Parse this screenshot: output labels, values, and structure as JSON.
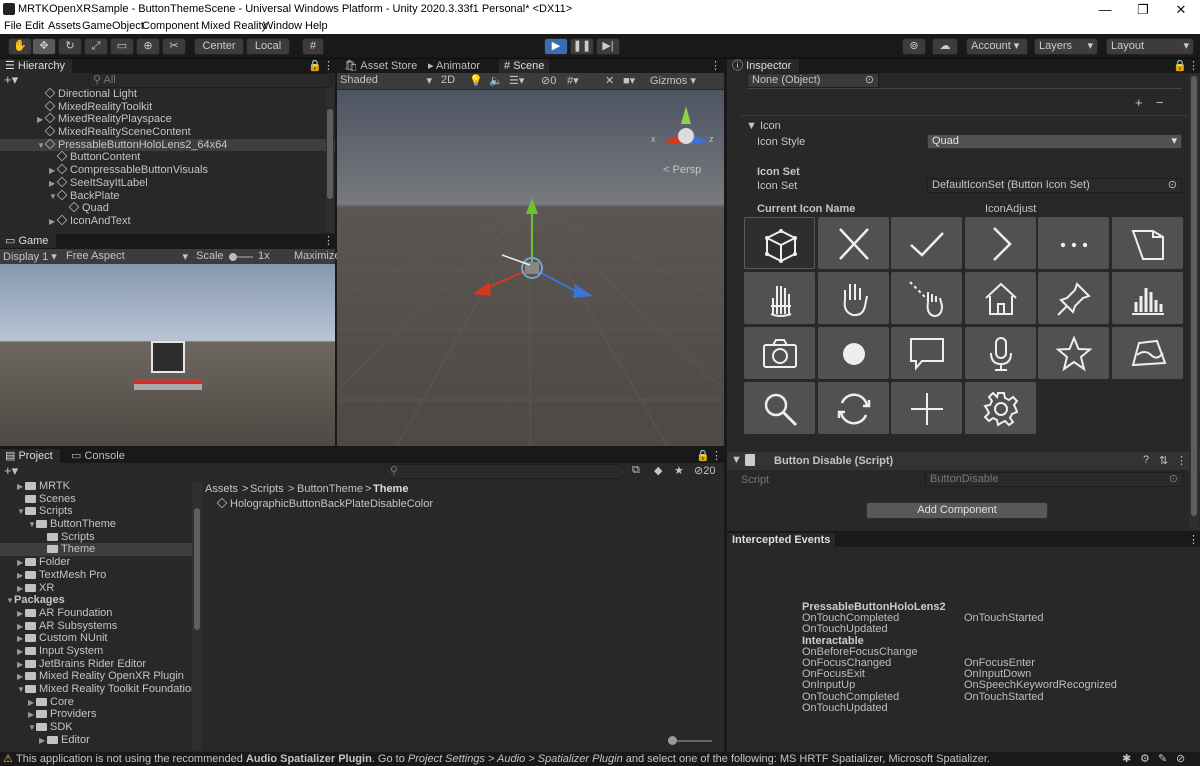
{
  "window": {
    "title": "MRTKOpenXRSample - ButtonThemeScene - Universal Windows Platform - Unity 2020.3.33f1 Personal* <DX11>",
    "min": "—",
    "max": "❐",
    "close": "✕"
  },
  "menu": [
    "File",
    "Edit",
    "Assets",
    "GameObject",
    "Component",
    "Mixed Reality",
    "Window",
    "Help"
  ],
  "toolbar": {
    "center": "Center",
    "local": "Local",
    "account": "Account",
    "layers": "Layers",
    "layout": "Layout"
  },
  "hierarchy": {
    "tab": "Hierarchy",
    "search_placeholder": "All",
    "items": [
      {
        "label": "Directional Light",
        "indent": 3,
        "arrow": ""
      },
      {
        "label": "MixedRealityToolkit",
        "indent": 3,
        "arrow": ""
      },
      {
        "label": "MixedRealityPlayspace",
        "indent": 3,
        "arrow": "▶"
      },
      {
        "label": "MixedRealitySceneContent",
        "indent": 3,
        "arrow": ""
      },
      {
        "label": "PressableButtonHoloLens2_64x64",
        "indent": 3,
        "arrow": "▼",
        "selected": true
      },
      {
        "label": "ButtonContent",
        "indent": 4,
        "arrow": ""
      },
      {
        "label": "CompressableButtonVisuals",
        "indent": 4,
        "arrow": "▶"
      },
      {
        "label": "SeeItSayItLabel",
        "indent": 4,
        "arrow": "▶"
      },
      {
        "label": "BackPlate",
        "indent": 4,
        "arrow": "▼"
      },
      {
        "label": "Quad",
        "indent": 5,
        "arrow": ""
      },
      {
        "label": "IconAndText",
        "indent": 4,
        "arrow": "▶"
      }
    ]
  },
  "game": {
    "tab": "Game",
    "display": "Display 1",
    "aspect": "Free Aspect",
    "scale_label": "Scale",
    "scale_value": "1x",
    "maximize": "Maximize"
  },
  "scene": {
    "tabs": [
      "Asset Store",
      "Animator",
      "Scene"
    ],
    "shading": "Shaded",
    "mode2d": "2D",
    "gizmos": "Gizmos",
    "hidden_count": "0",
    "persp": "Persp",
    "axis_x": "x",
    "axis_z": "z",
    "axis_y": "y"
  },
  "project": {
    "tabs": [
      "Project",
      "Console"
    ],
    "count": "20",
    "breadcrumb": [
      "Assets",
      "Scripts",
      "ButtonTheme",
      "Theme"
    ],
    "asset": "HolographicButtonBackPlateDisableColor",
    "tree": [
      {
        "label": "MRTK",
        "indent": 1,
        "arrow": "▶"
      },
      {
        "label": "Scenes",
        "indent": 1,
        "arrow": ""
      },
      {
        "label": "Scripts",
        "indent": 1,
        "arrow": "▼"
      },
      {
        "label": "ButtonTheme",
        "indent": 2,
        "arrow": "▼"
      },
      {
        "label": "Scripts",
        "indent": 3,
        "arrow": ""
      },
      {
        "label": "Theme",
        "indent": 3,
        "arrow": "",
        "selected": true
      },
      {
        "label": "Folder",
        "indent": 1,
        "arrow": "▶"
      },
      {
        "label": "TextMesh Pro",
        "indent": 1,
        "arrow": "▶"
      },
      {
        "label": "XR",
        "indent": 1,
        "arrow": "▶"
      },
      {
        "label": "Packages",
        "indent": 0,
        "arrow": "▼",
        "bold": true
      },
      {
        "label": "AR Foundation",
        "indent": 1,
        "arrow": "▶"
      },
      {
        "label": "AR Subsystems",
        "indent": 1,
        "arrow": "▶"
      },
      {
        "label": "Custom NUnit",
        "indent": 1,
        "arrow": "▶"
      },
      {
        "label": "Input System",
        "indent": 1,
        "arrow": "▶"
      },
      {
        "label": "JetBrains Rider Editor",
        "indent": 1,
        "arrow": "▶"
      },
      {
        "label": "Mixed Reality OpenXR Plugin",
        "indent": 1,
        "arrow": "▶"
      },
      {
        "label": "Mixed Reality Toolkit Foundation",
        "indent": 1,
        "arrow": "▼"
      },
      {
        "label": "Core",
        "indent": 2,
        "arrow": "▶"
      },
      {
        "label": "Providers",
        "indent": 2,
        "arrow": "▶"
      },
      {
        "label": "SDK",
        "indent": 2,
        "arrow": "▼"
      },
      {
        "label": "Editor",
        "indent": 3,
        "arrow": "▶"
      }
    ]
  },
  "inspector": {
    "tab": "Inspector",
    "none_object": "None (Object)",
    "icon_section": "Icon",
    "icon_style_label": "Icon Style",
    "icon_style_value": "Quad",
    "icon_set_heading": "Icon Set",
    "icon_set_label": "Icon Set",
    "icon_set_value": "DefaultIconSet (Button Icon Set)",
    "current_icon_name": "Current Icon Name",
    "icon_adjust": "IconAdjust",
    "icons": [
      "cube-icon",
      "close-icon",
      "check-icon",
      "chevron-right-icon",
      "more-icon",
      "document-icon",
      "hand-ray-icon",
      "hand-icon",
      "hand-select-icon",
      "home-icon",
      "pin-icon",
      "chart-icon",
      "camera-icon",
      "circle-icon",
      "speech-bubble-icon",
      "microphone-icon",
      "star-icon",
      "map-icon",
      "search-icon",
      "refresh-icon",
      "plus-icon",
      "gear-icon"
    ],
    "component_name": "Button Disable (Script)",
    "script_label": "Script",
    "script_value": "ButtonDisable",
    "add_component": "Add Component"
  },
  "events": {
    "tab": "Intercepted Events",
    "col1": [
      {
        "text": "PressableButtonHoloLens2",
        "bold": true
      },
      {
        "text": "OnTouchCompleted"
      },
      {
        "text": "OnTouchUpdated"
      },
      {
        "text": "Interactable",
        "bold": true
      },
      {
        "text": "OnBeforeFocusChange"
      },
      {
        "text": "OnFocusChanged"
      },
      {
        "text": "OnFocusExit"
      },
      {
        "text": "OnInputUp"
      },
      {
        "text": "OnTouchCompleted"
      },
      {
        "text": "OnTouchUpdated"
      }
    ],
    "col2": [
      {
        "text": "",
        "row": 0
      },
      {
        "text": "OnTouchStarted",
        "row": 1
      },
      {
        "text": "OnFocusEnter",
        "row": 5
      },
      {
        "text": "OnInputDown",
        "row": 6
      },
      {
        "text": "OnSpeechKeywordRecognized",
        "row": 7
      },
      {
        "text": "OnTouchStarted",
        "row": 8
      }
    ]
  },
  "status": {
    "pre": "This application is not using the recommended ",
    "b1": "Audio Spatializer Plugin",
    "mid": ". Go to ",
    "i1": "Project Settings > Audio > Spatializer Plugin",
    "post": " and select one of the following: MS HRTF Spatializer, Microsoft Spatializer."
  }
}
